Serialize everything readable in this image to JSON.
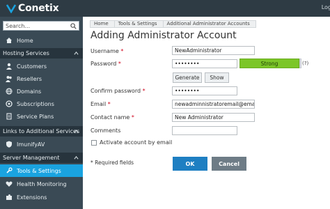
{
  "brand": {
    "name": "Conetix",
    "logo_color": "#1aa3e0"
  },
  "topbar": {
    "user_text": "Log"
  },
  "sidebar": {
    "search_placeholder": "Search...",
    "home": "Home",
    "sections": [
      {
        "label": "Hosting Services"
      },
      {
        "label": "Links to Additional Services"
      },
      {
        "label": "Server Management"
      }
    ],
    "hosting_items": [
      "Customers",
      "Resellers",
      "Domains",
      "Subscriptions",
      "Service Plans"
    ],
    "links_items": [
      "ImunifyAV"
    ],
    "server_items": [
      "Tools & Settings",
      "Health Monitoring",
      "Extensions"
    ],
    "active_color": "#1aa3e0"
  },
  "breadcrumb": [
    "Home",
    "Tools & Settings",
    "Additional Administrator Accounts"
  ],
  "page": {
    "title": "Adding Administrator Account"
  },
  "form": {
    "username_label": "Username",
    "username_value": "NewAdministrator",
    "password_label": "Password",
    "password_value": "••••••••",
    "strength": "Strong",
    "strength_hint": "(?)",
    "generate_label": "Generate",
    "show_label": "Show",
    "confirm_label": "Confirm password",
    "confirm_value": "••••••••",
    "email_label": "Email",
    "email_value": "newadminnistratoremail@email.c",
    "contact_label": "Contact name",
    "contact_value": "New Administrator",
    "comments_label": "Comments",
    "comments_value": "",
    "activate_label": "Activate account by email",
    "required_star": "*",
    "required_note": "* Required fields",
    "ok_label": "OK",
    "cancel_label": "Cancel"
  }
}
